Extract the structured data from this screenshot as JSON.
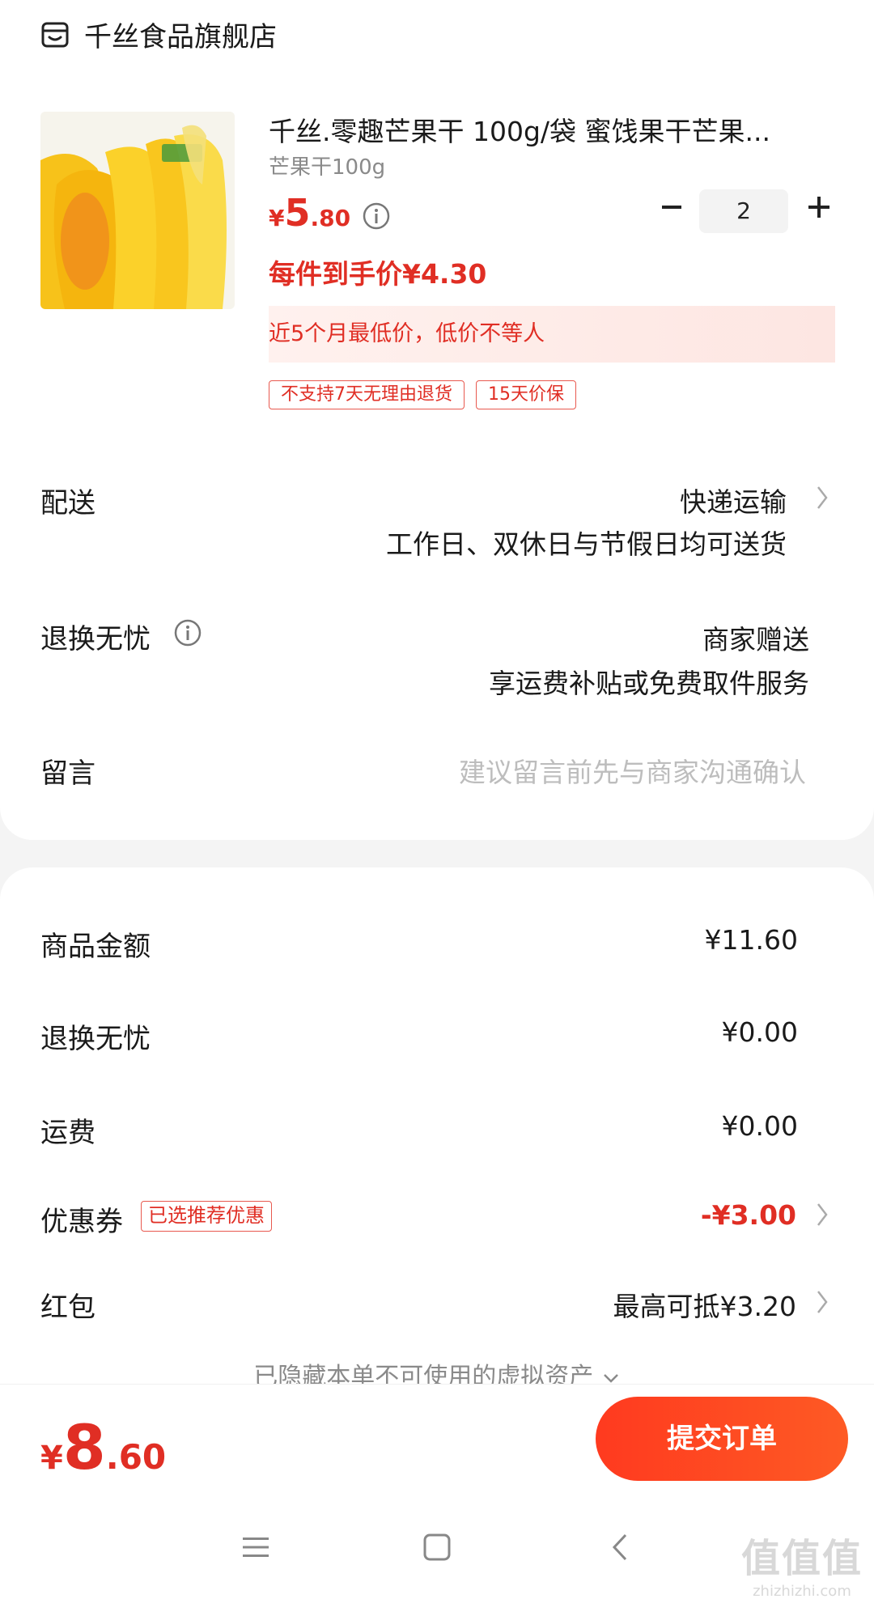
{
  "store": {
    "name": "千丝食品旗舰店",
    "icon": "store-icon"
  },
  "product": {
    "title": "千丝.零趣芒果干 100g/袋 蜜饯果干芒果...",
    "spec": "芒果干100g",
    "price_symbol": "¥",
    "price_int": "5",
    "price_dec": ".80",
    "quantity": "2",
    "final_price": "每件到手价¥4.30",
    "banner": "近5个月最低价，低价不等人",
    "tags": [
      "不支持7天无理由退货",
      "15天价保"
    ]
  },
  "delivery": {
    "label": "配送",
    "method": "快递运输",
    "note": "工作日、双休日与节假日均可送货"
  },
  "return_service": {
    "label": "退换无忧",
    "value": "商家赠送",
    "note": "享运费补贴或免费取件服务"
  },
  "message": {
    "label": "留言",
    "placeholder": "建议留言前先与商家沟通确认"
  },
  "summary": {
    "goods_label": "商品金额",
    "goods_value": "¥11.60",
    "return_label": "退换无忧",
    "return_value": "¥0.00",
    "shipping_label": "运费",
    "shipping_value": "¥0.00",
    "coupon_label": "优惠券",
    "coupon_badge": "已选推荐优惠",
    "coupon_value": "-¥3.00",
    "redpacket_label": "红包",
    "redpacket_value": "最高可抵¥3.20",
    "hidden_note": "已隐藏本单不可使用的虚拟资产"
  },
  "checkout": {
    "total_symbol": "¥",
    "total_int": "8",
    "total_dec": ".60",
    "submit_label": "提交订单"
  },
  "watermark": {
    "main": "值值值",
    "sub": "zhizhizhi.com"
  },
  "colors": {
    "accent": "#e02e24",
    "button": "#ff3a1f"
  }
}
